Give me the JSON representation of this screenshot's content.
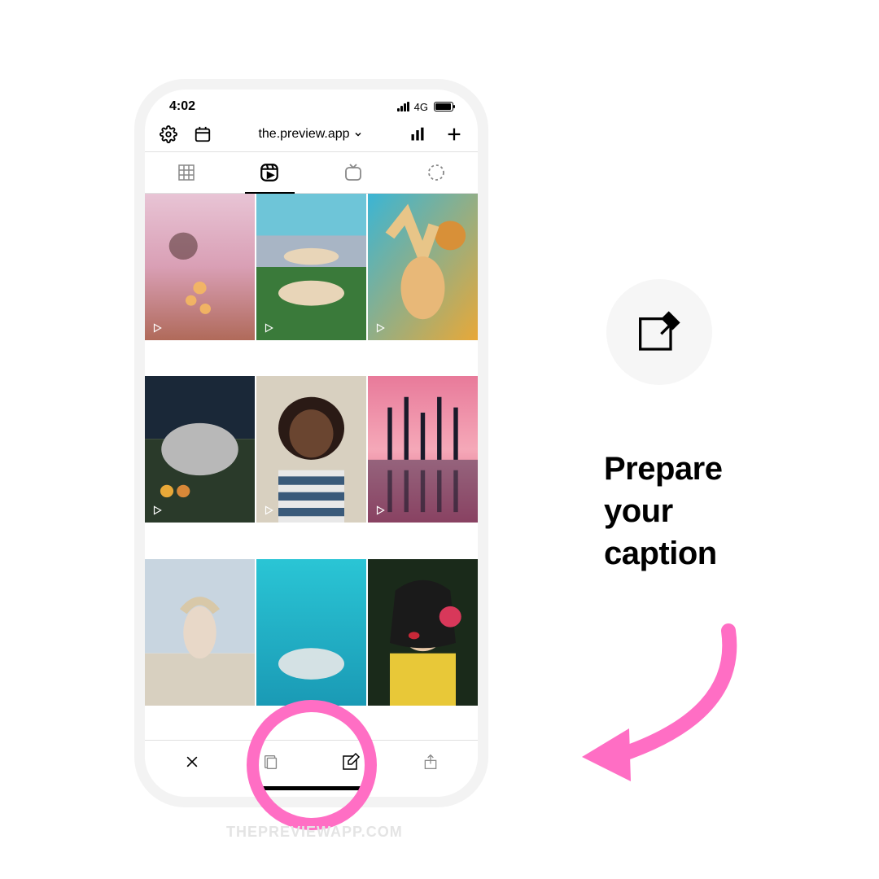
{
  "statusBar": {
    "time": "4:02",
    "network": "4G"
  },
  "header": {
    "accountName": "the.preview.app"
  },
  "thumbnails": [
    {
      "desc": "sunset silhouette"
    },
    {
      "desc": "acro yoga by sea"
    },
    {
      "desc": "woman with sunflower"
    },
    {
      "desc": "airstream trailer"
    },
    {
      "desc": "laughing woman"
    },
    {
      "desc": "pink palms reflection"
    },
    {
      "desc": "woman on beach"
    },
    {
      "desc": "aqua water plane"
    },
    {
      "desc": "woman red lips flower"
    }
  ],
  "callout": {
    "line1": "Prepare",
    "line2": "your",
    "line3": "caption"
  },
  "watermark": "THEPREVIEWAPP.COM"
}
